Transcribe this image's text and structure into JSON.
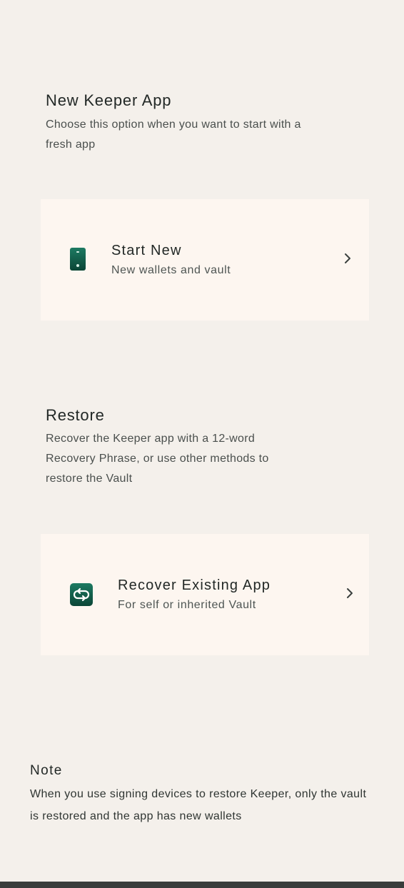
{
  "new_app": {
    "title": "New Keeper App",
    "description": "Choose this option when you want to start with a fresh app",
    "card": {
      "icon": "phone-icon",
      "title": "Start New",
      "subtitle": "New wallets and vault"
    }
  },
  "restore": {
    "title": "Restore",
    "description": "Recover the Keeper app with a 12-word Recovery Phrase, or use other methods to restore the Vault",
    "card": {
      "icon": "recover-arrows-icon",
      "title": "Recover Existing App",
      "subtitle": "For self or inherited Vault"
    }
  },
  "note": {
    "title": "Note",
    "text": "When you use signing devices to restore Keeper, only the vault is restored and the app has new wallets"
  },
  "colors": {
    "background": "#f4f0eb",
    "card_background": "#fdf6f0",
    "accent_green": "#0f5e4b"
  }
}
